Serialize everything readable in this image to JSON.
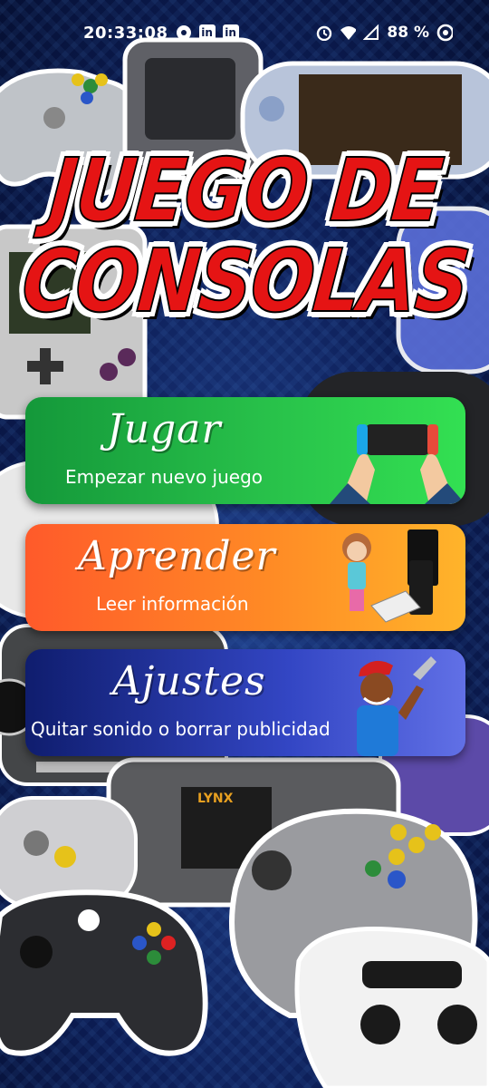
{
  "status_bar": {
    "time": "20:33:08",
    "battery": "88 %",
    "icons": [
      "notification-icon",
      "linkedin-icon",
      "linkedin-icon",
      "alarm-icon",
      "wifi-icon",
      "signal-icon",
      "sync-icon"
    ],
    "linkedin_glyph": "in"
  },
  "title": {
    "line1": "JUEGO DE",
    "line2": "CONSOLAS"
  },
  "menu": {
    "play": {
      "title": "Jugar",
      "subtitle": "Empezar nuevo juego",
      "icon": "hands-console-icon"
    },
    "learn": {
      "title": "Aprender",
      "subtitle": "Leer información",
      "icon": "girl-consoles-icon"
    },
    "settings": {
      "title": "Ajustes",
      "subtitle": "Quitar sonido o borrar publicidad",
      "icon": "repairman-icon"
    }
  },
  "colors": {
    "title_red": "#e51414",
    "play_green": "#28c14a",
    "learn_orange": "#ff8a25",
    "settings_blue": "#3346c4"
  }
}
